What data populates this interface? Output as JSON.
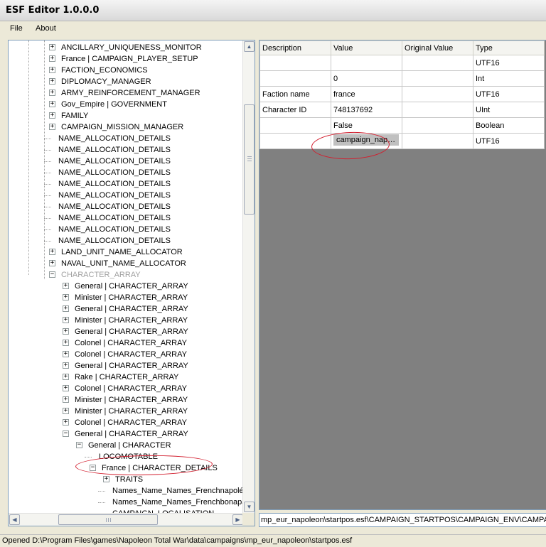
{
  "window": {
    "title": "ESF Editor 1.0.0.0"
  },
  "menu": [
    {
      "label": "File"
    },
    {
      "label": "About"
    }
  ],
  "tree": [
    {
      "label": "ANCILLARY_UNIQUENESS_MONITOR",
      "level": 0,
      "exp": "+"
    },
    {
      "label": "France | CAMPAIGN_PLAYER_SETUP",
      "level": 0,
      "exp": "+"
    },
    {
      "label": "FACTION_ECONOMICS",
      "level": 0,
      "exp": "+"
    },
    {
      "label": "DIPLOMACY_MANAGER",
      "level": 0,
      "exp": "+"
    },
    {
      "label": "ARMY_REINFORCEMENT_MANAGER",
      "level": 0,
      "exp": "+"
    },
    {
      "label": "Gov_Empire | GOVERNMENT",
      "level": 0,
      "exp": "+"
    },
    {
      "label": "FAMILY",
      "level": 0,
      "exp": "+"
    },
    {
      "label": "CAMPAIGN_MISSION_MANAGER",
      "level": 0,
      "exp": "+"
    },
    {
      "label": "NAME_ALLOCATION_DETAILS",
      "level": 0,
      "exp": ""
    },
    {
      "label": "NAME_ALLOCATION_DETAILS",
      "level": 0,
      "exp": ""
    },
    {
      "label": "NAME_ALLOCATION_DETAILS",
      "level": 0,
      "exp": ""
    },
    {
      "label": "NAME_ALLOCATION_DETAILS",
      "level": 0,
      "exp": ""
    },
    {
      "label": "NAME_ALLOCATION_DETAILS",
      "level": 0,
      "exp": ""
    },
    {
      "label": "NAME_ALLOCATION_DETAILS",
      "level": 0,
      "exp": ""
    },
    {
      "label": "NAME_ALLOCATION_DETAILS",
      "level": 0,
      "exp": ""
    },
    {
      "label": "NAME_ALLOCATION_DETAILS",
      "level": 0,
      "exp": ""
    },
    {
      "label": "NAME_ALLOCATION_DETAILS",
      "level": 0,
      "exp": ""
    },
    {
      "label": "NAME_ALLOCATION_DETAILS",
      "level": 0,
      "exp": ""
    },
    {
      "label": "LAND_UNIT_NAME_ALLOCATOR",
      "level": 0,
      "exp": "+"
    },
    {
      "label": "NAVAL_UNIT_NAME_ALLOCATOR",
      "level": 0,
      "exp": "+"
    },
    {
      "label": "CHARACTER_ARRAY",
      "level": 0,
      "exp": "-",
      "gray": true
    },
    {
      "label": "General | CHARACTER_ARRAY",
      "level": 1,
      "exp": "+"
    },
    {
      "label": "Minister | CHARACTER_ARRAY",
      "level": 1,
      "exp": "+"
    },
    {
      "label": "General | CHARACTER_ARRAY",
      "level": 1,
      "exp": "+"
    },
    {
      "label": "Minister | CHARACTER_ARRAY",
      "level": 1,
      "exp": "+"
    },
    {
      "label": "General | CHARACTER_ARRAY",
      "level": 1,
      "exp": "+"
    },
    {
      "label": "Colonel | CHARACTER_ARRAY",
      "level": 1,
      "exp": "+"
    },
    {
      "label": "Colonel | CHARACTER_ARRAY",
      "level": 1,
      "exp": "+"
    },
    {
      "label": "General | CHARACTER_ARRAY",
      "level": 1,
      "exp": "+"
    },
    {
      "label": "Rake | CHARACTER_ARRAY",
      "level": 1,
      "exp": "+"
    },
    {
      "label": "Colonel | CHARACTER_ARRAY",
      "level": 1,
      "exp": "+"
    },
    {
      "label": "Minister | CHARACTER_ARRAY",
      "level": 1,
      "exp": "+"
    },
    {
      "label": "Minister | CHARACTER_ARRAY",
      "level": 1,
      "exp": "+"
    },
    {
      "label": "Colonel | CHARACTER_ARRAY",
      "level": 1,
      "exp": "+"
    },
    {
      "label": "General | CHARACTER_ARRAY",
      "level": 1,
      "exp": "-"
    },
    {
      "label": "General | CHARACTER",
      "level": 2,
      "exp": "-"
    },
    {
      "label": "LOCOMOTABLE",
      "level": 3,
      "exp": ""
    },
    {
      "label": "France | CHARACTER_DETAILS",
      "level": 3,
      "exp": "-"
    },
    {
      "label": "TRAITS",
      "level": 4,
      "exp": "+"
    },
    {
      "label": "Names_Name_Names_Frenchnapoléon",
      "level": 4,
      "exp": ""
    },
    {
      "label": "Names_Name_Names_Frenchbonaparte",
      "level": 4,
      "exp": ""
    },
    {
      "label": "CAMPAIGN_LOCALISATION",
      "level": 4,
      "exp": ""
    }
  ],
  "grid": {
    "columns": [
      "Description",
      "Value",
      "Original Value",
      "Type"
    ],
    "rows": [
      {
        "description": "",
        "value": "",
        "original": "",
        "type": "UTF16"
      },
      {
        "description": "",
        "value": "0",
        "original": "",
        "type": "Int"
      },
      {
        "description": "Faction name",
        "value": "france",
        "original": "",
        "type": "UTF16"
      },
      {
        "description": "Character ID",
        "value": "748137692",
        "original": "",
        "type": "UInt"
      },
      {
        "description": "",
        "value": "False",
        "original": "",
        "type": "Boolean"
      },
      {
        "description": "",
        "value": "campaign_napoleon",
        "original": "",
        "type": "UTF16",
        "selected": true
      }
    ]
  },
  "path": "mp_eur_napoleon\\startpos.esf\\CAMPAIGN_STARTPOS\\CAMPAIGN_ENV\\CAMPAIGN_MODEL\\WORLD\\FACTION_ARRAY",
  "status": "Opened D:\\Program Files\\games\\Napoleon Total War\\data\\campaigns\\mp_eur_napoleon\\startpos.esf",
  "colors": {
    "highlight": "#d21f2f",
    "grid_background": "#808080",
    "border": "#7f9db9"
  }
}
